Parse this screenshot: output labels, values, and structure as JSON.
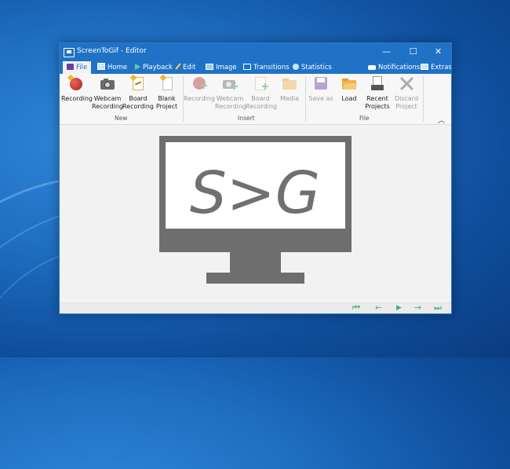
{
  "window": {
    "title": "ScreenToGif - Editor",
    "controls": {
      "minimize": "—",
      "maximize": "☐",
      "close": "✕"
    }
  },
  "tabs": [
    {
      "label": "File",
      "icon": "save-icon"
    },
    {
      "label": "Home",
      "icon": "home-icon"
    },
    {
      "label": "Playback",
      "icon": "play-icon"
    },
    {
      "label": "Edit",
      "icon": "pencil-icon"
    },
    {
      "label": "Image",
      "icon": "image-icon"
    },
    {
      "label": "Transitions",
      "icon": "transitions-icon"
    },
    {
      "label": "Statistics",
      "icon": "info-icon"
    }
  ],
  "right_tabs": {
    "notifications": "Notifications",
    "extras": "Extras"
  },
  "ribbon": {
    "new": {
      "label": "New",
      "recording": "Recording",
      "webcam_1": "Webcam",
      "webcam_2": "Recording",
      "board_1": "Board",
      "board_2": "Recording",
      "blank_1": "Blank",
      "blank_2": "Project"
    },
    "insert": {
      "label": "Insert",
      "recording": "Recording",
      "webcam_1": "Webcam",
      "webcam_2": "Recording",
      "board_1": "Board",
      "board_2": "Recording",
      "media": "Media"
    },
    "file": {
      "label": "File",
      "save_as": "Save as",
      "load": "Load",
      "recent_1": "Recent",
      "recent_2": "Projects",
      "discard_1": "Discard",
      "discard_2": "Project"
    },
    "collapse": "︿"
  },
  "logo": {
    "text": "S>G"
  },
  "statusbar": {
    "first": "⏮",
    "previous": "←",
    "play": "▶",
    "next": "→",
    "last": "⏭"
  },
  "colors": {
    "accent": "#1f72c6",
    "nav_green": "#47b27a",
    "logo_gray": "#6e6e6e"
  }
}
